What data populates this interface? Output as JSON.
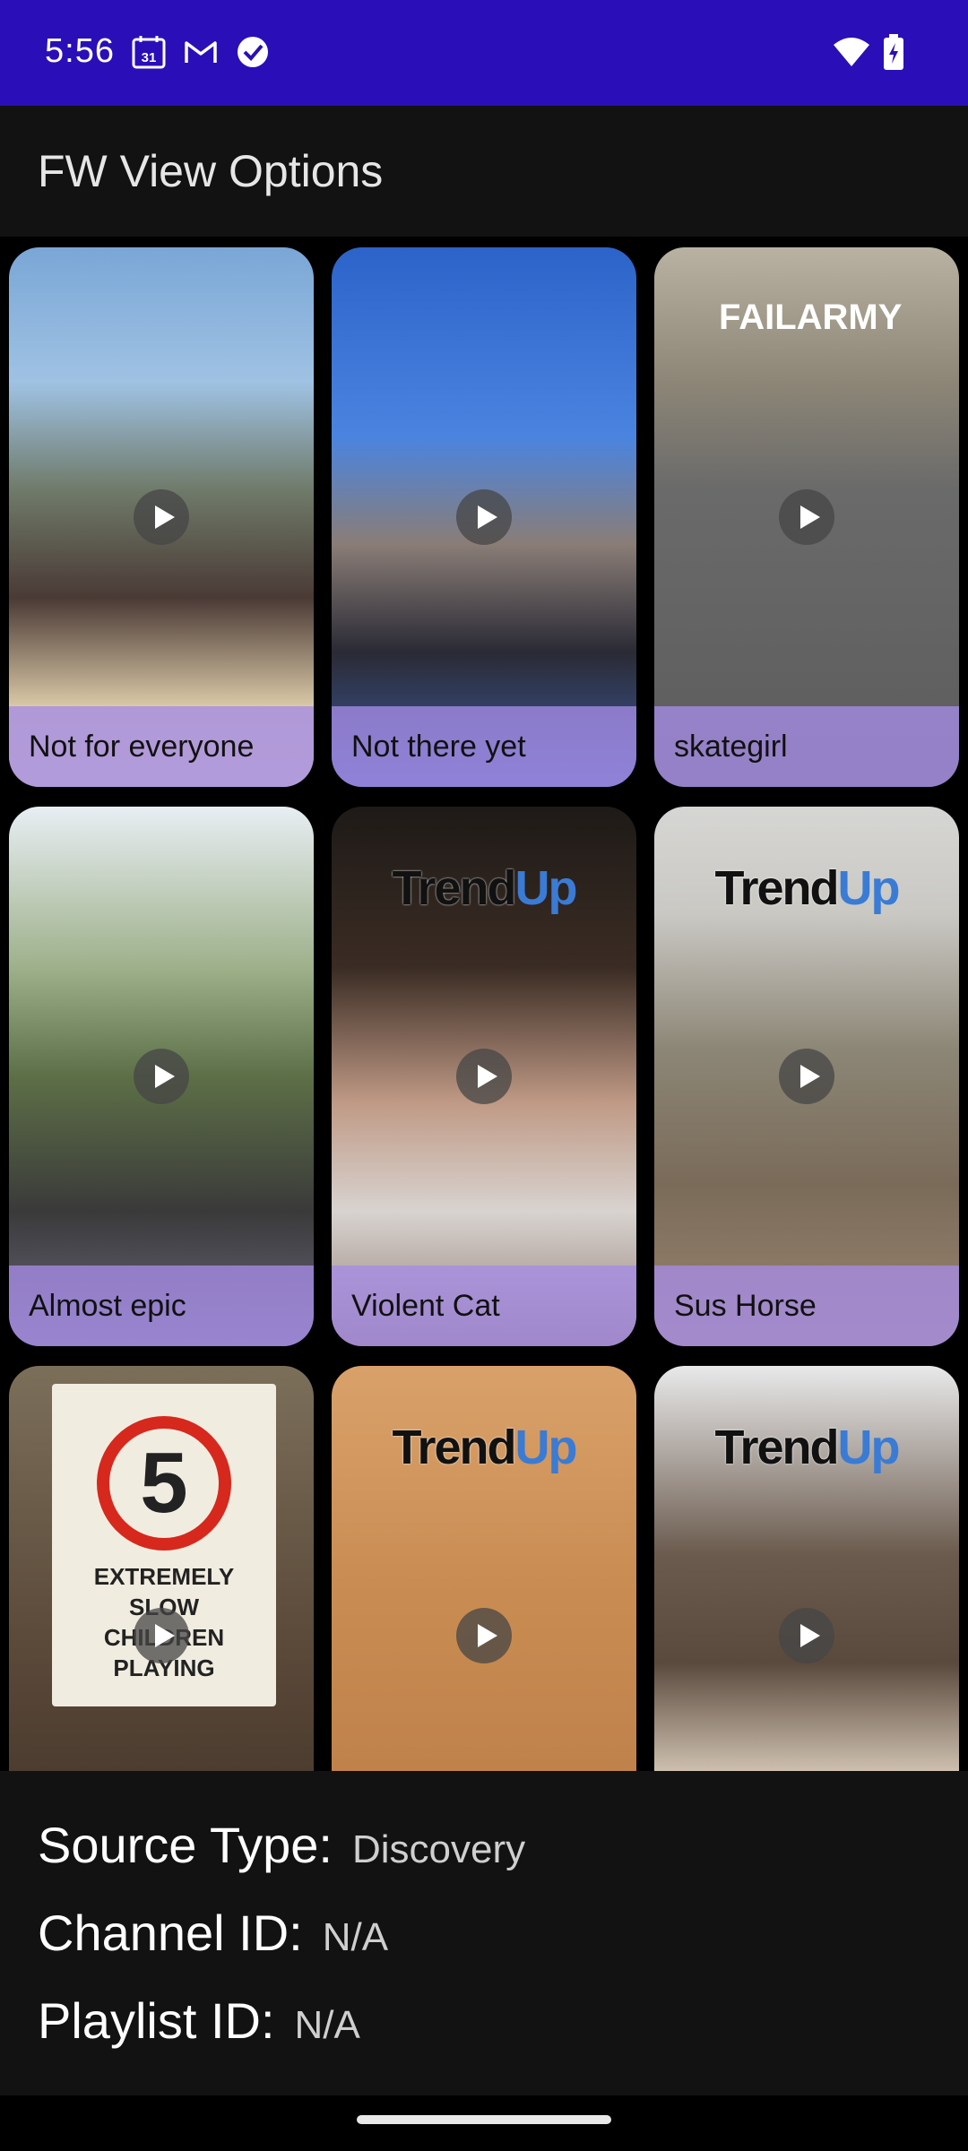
{
  "status_bar": {
    "time": "5:56",
    "calendar_day": "31",
    "icons": [
      "calendar-icon",
      "gmail-icon",
      "check-circle-icon",
      "wifi-icon",
      "battery-charging-icon"
    ]
  },
  "app_bar": {
    "title": "FW View Options"
  },
  "videos": [
    {
      "title": "Not for everyone",
      "thumbnail": "beach-dance"
    },
    {
      "title": "Not there yet",
      "thumbnail": "handstand-pool"
    },
    {
      "title": "skategirl",
      "thumbnail": "skateboard-parking",
      "brand": "FAILARMY"
    },
    {
      "title": "Almost epic",
      "thumbnail": "jenga-tower"
    },
    {
      "title": "Violent Cat",
      "thumbnail": "girl-with-cat",
      "brand": "TrendUp"
    },
    {
      "title": "Sus Horse",
      "thumbnail": "horses-in-blankets",
      "brand": "TrendUp"
    },
    {
      "title": "",
      "thumbnail": "speed-sign",
      "sign": {
        "number": "5",
        "lines": [
          "EXTREMELY",
          "SLOW",
          "CHILDREN",
          "PLAYING"
        ]
      }
    },
    {
      "title": "",
      "thumbnail": "hand-on-wood",
      "brand": "TrendUp"
    },
    {
      "title": "",
      "thumbnail": "living-room",
      "brand": "TrendUp"
    }
  ],
  "brand_parts": {
    "trend": "Trend",
    "up": "Up"
  },
  "info": {
    "source_type_label": "Source Type:",
    "source_type_value": "Discovery",
    "channel_id_label": "Channel ID:",
    "channel_id_value": "N/A",
    "playlist_id_label": "Playlist ID:",
    "playlist_id_value": "N/A"
  }
}
